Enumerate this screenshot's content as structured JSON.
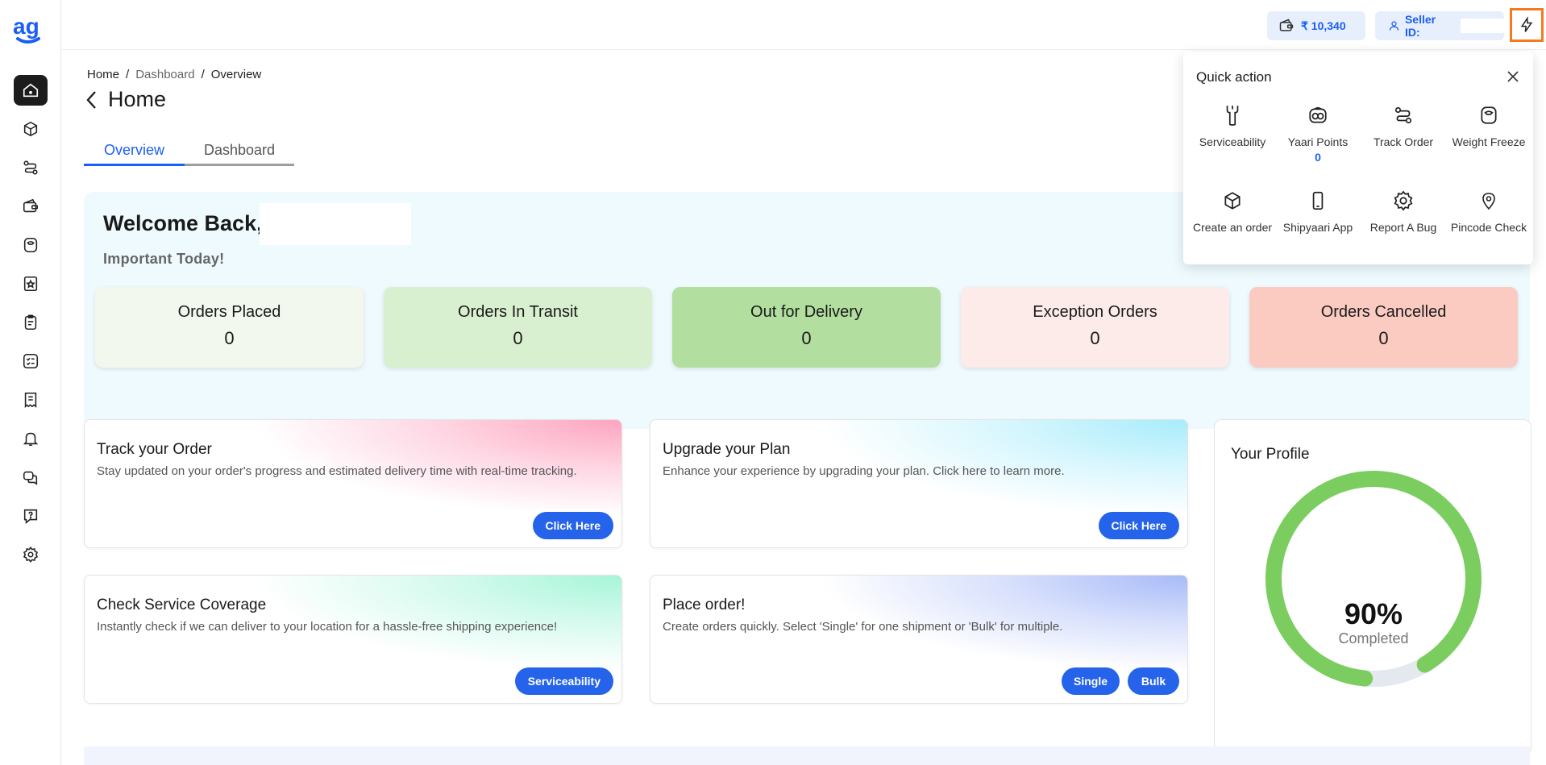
{
  "brand": {
    "logo_text": "ag",
    "color": "#1b5ef7"
  },
  "sidebar": {
    "items": [
      {
        "name": "home",
        "icon": "home-icon",
        "active": true
      },
      {
        "name": "orders",
        "icon": "cube-icon"
      },
      {
        "name": "tracking",
        "icon": "route-icon"
      },
      {
        "name": "wallet",
        "icon": "wallet-icon"
      },
      {
        "name": "weight",
        "icon": "weight-icon"
      },
      {
        "name": "ndr",
        "icon": "badge-star-icon"
      },
      {
        "name": "returns",
        "icon": "clipboard-icon"
      },
      {
        "name": "checklist",
        "icon": "checklist-icon"
      },
      {
        "name": "billing",
        "icon": "receipt-icon"
      },
      {
        "name": "notifications",
        "icon": "bell-icon"
      },
      {
        "name": "support",
        "icon": "chat-icon"
      },
      {
        "name": "help",
        "icon": "question-icon"
      },
      {
        "name": "settings",
        "icon": "gear-icon"
      }
    ]
  },
  "header": {
    "wallet_amount": "₹ 10,340",
    "seller_label": "Seller ID:"
  },
  "breadcrumb": {
    "home": "Home",
    "sep": "/",
    "mid": "Dashboard",
    "current": "Overview"
  },
  "page_title": "Home",
  "tabs": [
    "Overview",
    "Dashboard"
  ],
  "welcome": {
    "greeting": "Welcome Back,",
    "subtitle": "Important Today!"
  },
  "stats": [
    {
      "label": "Orders Placed",
      "value": "0",
      "color": "#f2f8ee"
    },
    {
      "label": "Orders In Transit",
      "value": "0",
      "color": "#d8f0cf"
    },
    {
      "label": "Out for Delivery",
      "value": "0",
      "color": "#b2df9f"
    },
    {
      "label": "Exception Orders",
      "value": "0",
      "color": "#fdebe9"
    },
    {
      "label": "Orders Cancelled",
      "value": "0",
      "color": "#fbcbc2"
    }
  ],
  "cards": {
    "track": {
      "title": "Track your Order",
      "desc": "Stay updated on your order's progress and estimated delivery time with real-time tracking.",
      "button": "Click Here"
    },
    "upgrade": {
      "title": "Upgrade your Plan",
      "desc": "Enhance your experience by upgrading your plan. Click here to learn more.",
      "button": "Click Here"
    },
    "coverage": {
      "title": "Check Service Coverage",
      "desc": "Instantly check if we can deliver to your location for a hassle-free shipping experience!",
      "button": "Serviceability"
    },
    "place": {
      "title": "Place order!",
      "desc": "Create orders quickly. Select 'Single' for one shipment or 'Bulk' for multiple.",
      "button_single": "Single",
      "button_bulk": "Bulk"
    }
  },
  "profile": {
    "title": "Your Profile",
    "percent": "90%",
    "percent_value": 0.9,
    "status": "Completed"
  },
  "quick_action": {
    "title": "Quick action",
    "items": [
      {
        "label": "Serviceability",
        "icon": "wrench-icon"
      },
      {
        "label": "Yaari Points",
        "sub": "0",
        "icon": "coins-icon"
      },
      {
        "label": "Track Order",
        "icon": "route-icon"
      },
      {
        "label": "Weight Freeze",
        "icon": "weight-icon"
      },
      {
        "label": "Create an order",
        "icon": "cube-icon"
      },
      {
        "label": "Shipyaari App",
        "icon": "phone-icon"
      },
      {
        "label": "Report A Bug",
        "icon": "gear-icon"
      },
      {
        "label": "Pincode Check",
        "icon": "pin-icon"
      }
    ]
  }
}
